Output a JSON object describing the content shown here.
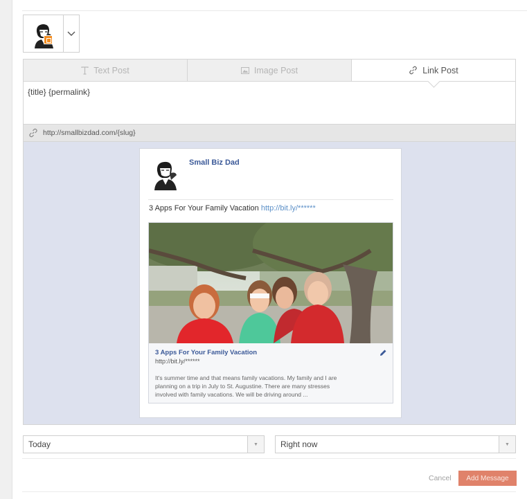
{
  "composer": {
    "account_avatar_icon": "profile-avatar",
    "account_badge_icon": "blogger-badge-icon",
    "dropdown_icon": "chevron-down-icon"
  },
  "tabs": [
    {
      "label": "Text Post",
      "icon": "text-icon",
      "active": false
    },
    {
      "label": "Image Post",
      "icon": "image-icon",
      "active": false
    },
    {
      "label": "Link Post",
      "icon": "link-icon",
      "active": true
    }
  ],
  "editor": {
    "text": "{title} {permalink}"
  },
  "link_bar": {
    "url": "http://smallbizdad.com/{slug}",
    "icon": "link-icon"
  },
  "preview": {
    "page_name": "Small Biz Dad",
    "message_text": "3 Apps For Your Family Vacation",
    "message_link": "http://bit.ly/******",
    "link_title": "3 Apps For Your Family Vacation",
    "link_url": "http://bit.ly/******",
    "link_description": "It's summer time and that means family vacations.  My family and I are\nplanning on a trip in July to St. Augustine.  There are many stresses\ninvolved with family vacations.  We will be driving around ..."
  },
  "schedule": {
    "date_value": "Today",
    "time_value": "Right now"
  },
  "actions": {
    "cancel_label": "Cancel",
    "add_label": "Add Message"
  },
  "colors": {
    "facebook_blue": "#3b5998",
    "preview_bg": "#dde1ee",
    "add_button": "#e0826a",
    "badge_orange": "#f28b1e"
  }
}
